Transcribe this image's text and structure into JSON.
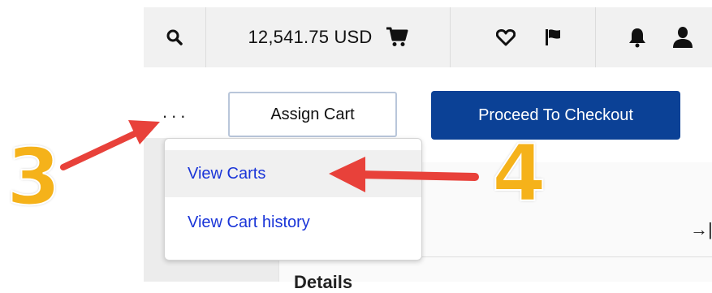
{
  "header": {
    "cart_total": "12,541.75 USD",
    "icons": [
      "search-icon",
      "cart-icon",
      "heart-icon",
      "flag-icon",
      "bell-icon",
      "user-icon"
    ]
  },
  "toolbar": {
    "more_label": "...",
    "assign_cart_label": "Assign Cart",
    "checkout_label": "Proceed To Checkout"
  },
  "menu": {
    "items": [
      {
        "label": "View Carts",
        "highlighted": true
      },
      {
        "label": "View Cart history",
        "highlighted": false
      }
    ]
  },
  "panel": {
    "heading": "Details"
  },
  "annotations": {
    "step_3": "3",
    "step_4": "4"
  },
  "colors": {
    "primary_button": "#0b4196",
    "menu_link": "#1a35d8",
    "annotation_number": "#f5b21a",
    "annotation_arrow": "#e8413a"
  }
}
